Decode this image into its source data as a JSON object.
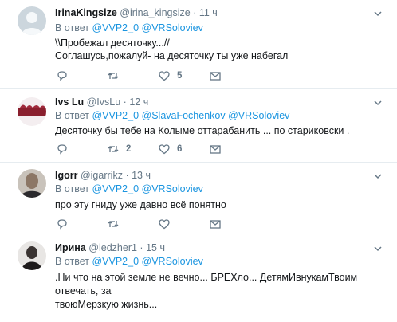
{
  "reply_prefix": "В ответ",
  "tweets": [
    {
      "name": "IrinaKingsize",
      "handle": "@irina_kingsize",
      "time": "11 ч",
      "mentions": [
        "@VVP2_0",
        "@VRSoloviev"
      ],
      "lines": [
        "\\\\Пробежал десяточку...//",
        "Соглашусь,пожалуй- на десяточку ты уже набегал"
      ],
      "replies": "",
      "retweets": "",
      "likes": "5"
    },
    {
      "name": "Ivs Lu",
      "handle": "@IvsLu",
      "time": "12 ч",
      "mentions": [
        "@VVP2_0",
        "@SlavaFochenkov",
        "@VRSoloviev"
      ],
      "lines": [
        "Десяточку бы тебе на Колыме оттарабанить ... по стариковски ."
      ],
      "replies": "",
      "retweets": "2",
      "likes": "6"
    },
    {
      "name": "Igorr",
      "handle": "@igarrikz",
      "time": "13 ч",
      "mentions": [
        "@VVP2_0",
        "@VRSoloviev"
      ],
      "lines": [
        "про эту гниду уже давно всё понятно"
      ],
      "replies": "",
      "retweets": "",
      "likes": ""
    },
    {
      "name": "Ирина",
      "handle": "@ledzher1",
      "time": "15 ч",
      "mentions": [
        "@VVP2_0",
        "@VRSoloviev"
      ],
      "lines": [
        ".Ни что на этой земле не вечно... БРЕХло... ДетямИвнукамТвоим отвечать, за",
        "твоюМерзкую жизнь..."
      ],
      "replies": "",
      "retweets": "",
      "likes": ""
    }
  ],
  "icons": {
    "reply": "reply-icon",
    "retweet": "retweet-icon",
    "like": "heart-icon",
    "dm": "envelope-icon",
    "more": "chevron-down-icon"
  },
  "colors": {
    "link": "#1b95e0",
    "muted": "#657786",
    "divider": "#e6ecf0"
  }
}
